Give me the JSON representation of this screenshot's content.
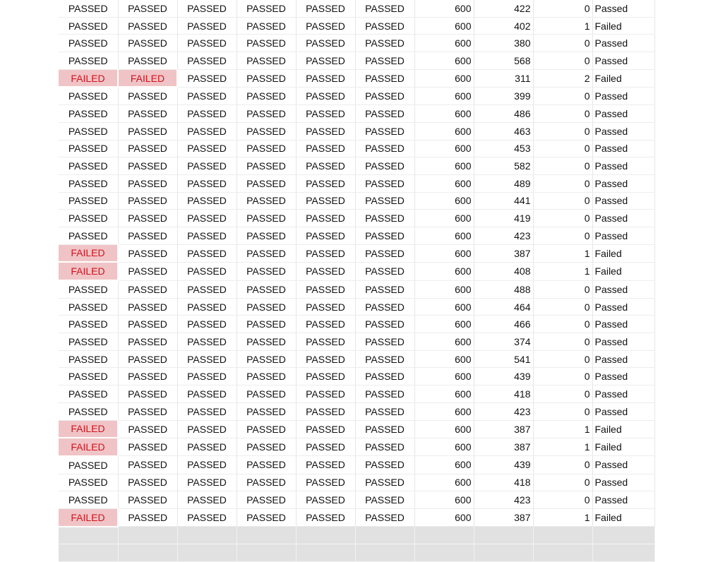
{
  "failed_fill": "#f0c4c6",
  "failed_text_color": "#d0131e",
  "rows": [
    [
      "PASSED",
      "PASSED",
      "PASSED",
      "PASSED",
      "PASSED",
      "PASSED",
      "600",
      "422",
      "0",
      "Passed"
    ],
    [
      "PASSED",
      "PASSED",
      "PASSED",
      "PASSED",
      "PASSED",
      "PASSED",
      "600",
      "402",
      "1",
      "Failed"
    ],
    [
      "PASSED",
      "PASSED",
      "PASSED",
      "PASSED",
      "PASSED",
      "PASSED",
      "600",
      "380",
      "0",
      "Passed"
    ],
    [
      "PASSED",
      "PASSED",
      "PASSED",
      "PASSED",
      "PASSED",
      "PASSED",
      "600",
      "568",
      "0",
      "Passed"
    ],
    [
      "FAILED",
      "FAILED",
      "PASSED",
      "PASSED",
      "PASSED",
      "PASSED",
      "600",
      "311",
      "2",
      "Failed"
    ],
    [
      "PASSED",
      "PASSED",
      "PASSED",
      "PASSED",
      "PASSED",
      "PASSED",
      "600",
      "399",
      "0",
      "Passed"
    ],
    [
      "PASSED",
      "PASSED",
      "PASSED",
      "PASSED",
      "PASSED",
      "PASSED",
      "600",
      "486",
      "0",
      "Passed"
    ],
    [
      "PASSED",
      "PASSED",
      "PASSED",
      "PASSED",
      "PASSED",
      "PASSED",
      "600",
      "463",
      "0",
      "Passed"
    ],
    [
      "PASSED",
      "PASSED",
      "PASSED",
      "PASSED",
      "PASSED",
      "PASSED",
      "600",
      "453",
      "0",
      "Passed"
    ],
    [
      "PASSED",
      "PASSED",
      "PASSED",
      "PASSED",
      "PASSED",
      "PASSED",
      "600",
      "582",
      "0",
      "Passed"
    ],
    [
      "PASSED",
      "PASSED",
      "PASSED",
      "PASSED",
      "PASSED",
      "PASSED",
      "600",
      "489",
      "0",
      "Passed"
    ],
    [
      "PASSED",
      "PASSED",
      "PASSED",
      "PASSED",
      "PASSED",
      "PASSED",
      "600",
      "441",
      "0",
      "Passed"
    ],
    [
      "PASSED",
      "PASSED",
      "PASSED",
      "PASSED",
      "PASSED",
      "PASSED",
      "600",
      "419",
      "0",
      "Passed"
    ],
    [
      "PASSED",
      "PASSED",
      "PASSED",
      "PASSED",
      "PASSED",
      "PASSED",
      "600",
      "423",
      "0",
      "Passed"
    ],
    [
      "FAILED",
      "PASSED",
      "PASSED",
      "PASSED",
      "PASSED",
      "PASSED",
      "600",
      "387",
      "1",
      "Failed"
    ],
    [
      "FAILED",
      "PASSED",
      "PASSED",
      "PASSED",
      "PASSED",
      "PASSED",
      "600",
      "408",
      "1",
      "Failed"
    ],
    [
      "PASSED",
      "PASSED",
      "PASSED",
      "PASSED",
      "PASSED",
      "PASSED",
      "600",
      "488",
      "0",
      "Passed"
    ],
    [
      "PASSED",
      "PASSED",
      "PASSED",
      "PASSED",
      "PASSED",
      "PASSED",
      "600",
      "464",
      "0",
      "Passed"
    ],
    [
      "PASSED",
      "PASSED",
      "PASSED",
      "PASSED",
      "PASSED",
      "PASSED",
      "600",
      "466",
      "0",
      "Passed"
    ],
    [
      "PASSED",
      "PASSED",
      "PASSED",
      "PASSED",
      "PASSED",
      "PASSED",
      "600",
      "374",
      "0",
      "Passed"
    ],
    [
      "PASSED",
      "PASSED",
      "PASSED",
      "PASSED",
      "PASSED",
      "PASSED",
      "600",
      "541",
      "0",
      "Passed"
    ],
    [
      "PASSED",
      "PASSED",
      "PASSED",
      "PASSED",
      "PASSED",
      "PASSED",
      "600",
      "439",
      "0",
      "Passed"
    ],
    [
      "PASSED",
      "PASSED",
      "PASSED",
      "PASSED",
      "PASSED",
      "PASSED",
      "600",
      "418",
      "0",
      "Passed"
    ],
    [
      "PASSED",
      "PASSED",
      "PASSED",
      "PASSED",
      "PASSED",
      "PASSED",
      "600",
      "423",
      "0",
      "Passed"
    ],
    [
      "FAILED",
      "PASSED",
      "PASSED",
      "PASSED",
      "PASSED",
      "PASSED",
      "600",
      "387",
      "1",
      "Failed"
    ],
    [
      "FAILED",
      "PASSED",
      "PASSED",
      "PASSED",
      "PASSED",
      "PASSED",
      "600",
      "387",
      "1",
      "Failed"
    ],
    [
      "PASSED",
      "PASSED",
      "PASSED",
      "PASSED",
      "PASSED",
      "PASSED",
      "600",
      "439",
      "0",
      "Passed"
    ],
    [
      "PASSED",
      "PASSED",
      "PASSED",
      "PASSED",
      "PASSED",
      "PASSED",
      "600",
      "418",
      "0",
      "Passed"
    ],
    [
      "PASSED",
      "PASSED",
      "PASSED",
      "PASSED",
      "PASSED",
      "PASSED",
      "600",
      "423",
      "0",
      "Passed"
    ],
    [
      "FAILED",
      "PASSED",
      "PASSED",
      "PASSED",
      "PASSED",
      "PASSED",
      "600",
      "387",
      "1",
      "Failed"
    ]
  ]
}
